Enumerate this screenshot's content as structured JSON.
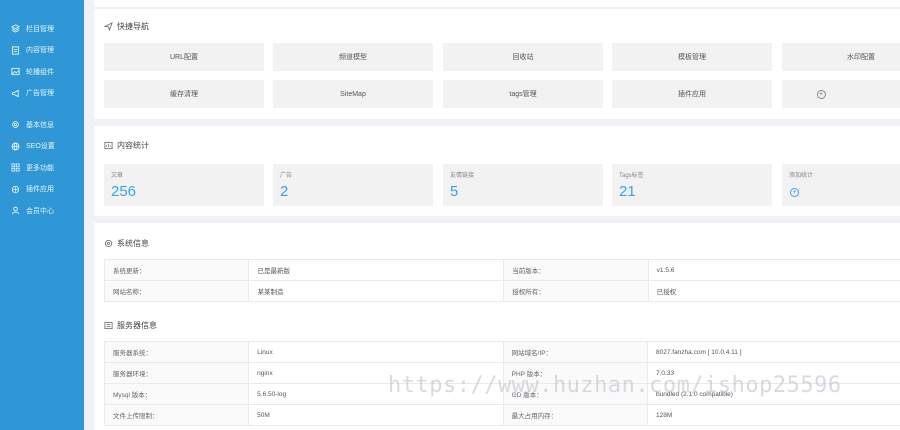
{
  "sidebar": {
    "group1": [
      {
        "icon": "layers-icon",
        "label": "栏目管理"
      },
      {
        "icon": "file-icon",
        "label": "内容管理"
      },
      {
        "icon": "image-icon",
        "label": "轮播组件"
      },
      {
        "icon": "megaphone-icon",
        "label": "广告管理"
      }
    ],
    "group2": [
      {
        "icon": "gear-icon",
        "label": "基本信息"
      },
      {
        "icon": "globe-icon",
        "label": "SEO设置"
      },
      {
        "icon": "grid-icon",
        "label": "更多功能"
      },
      {
        "icon": "plugin-icon",
        "label": "插件应用"
      },
      {
        "icon": "user-icon",
        "label": "会员中心"
      }
    ]
  },
  "quicknav": {
    "title": "快捷导航",
    "row1": [
      "URL配置",
      "频道模型",
      "回收站",
      "模板管理",
      "水印配置"
    ],
    "row2": [
      "缓存清理",
      "SiteMap",
      "tags管理",
      "插件应用"
    ]
  },
  "stats": {
    "title": "内容统计",
    "items": [
      {
        "label": "文章",
        "value": "256"
      },
      {
        "label": "广告",
        "value": "2"
      },
      {
        "label": "友情链接",
        "value": "5"
      },
      {
        "label": "Tags标签",
        "value": "21"
      },
      {
        "label": "添加统计",
        "value": ""
      }
    ]
  },
  "sysinfo": {
    "title": "系统信息",
    "rows": [
      {
        "k1": "系统更新：",
        "v1": "已是最新版",
        "k2": "当前版本：",
        "v2": "v1.5.6"
      },
      {
        "k1": "网站名称：",
        "v1": "某某制造",
        "k2": "授权所有：",
        "v2": "已授权"
      }
    ]
  },
  "server": {
    "title": "服务器信息",
    "rows": [
      {
        "k1": "服务器系统：",
        "v1": "Linux",
        "k2": "网站域名/IP：",
        "v2": "8027.fanzha.com [ 10.0.4.11 ]"
      },
      {
        "k1": "服务器环境：",
        "v1": "nginx",
        "k2": "PHP 版本：",
        "v2": "7.0.33"
      },
      {
        "k1": "Mysql 版本：",
        "v1": "5.6.50-log",
        "k2": "GD 版本：",
        "v2": "bundled (2.1.0 compatible)"
      },
      {
        "k1": "文件上传限制：",
        "v1": "50M",
        "k2": "最大占用内存：",
        "v2": "128M"
      }
    ]
  },
  "watermark": "https://www.huzhan.com/ishop25596"
}
